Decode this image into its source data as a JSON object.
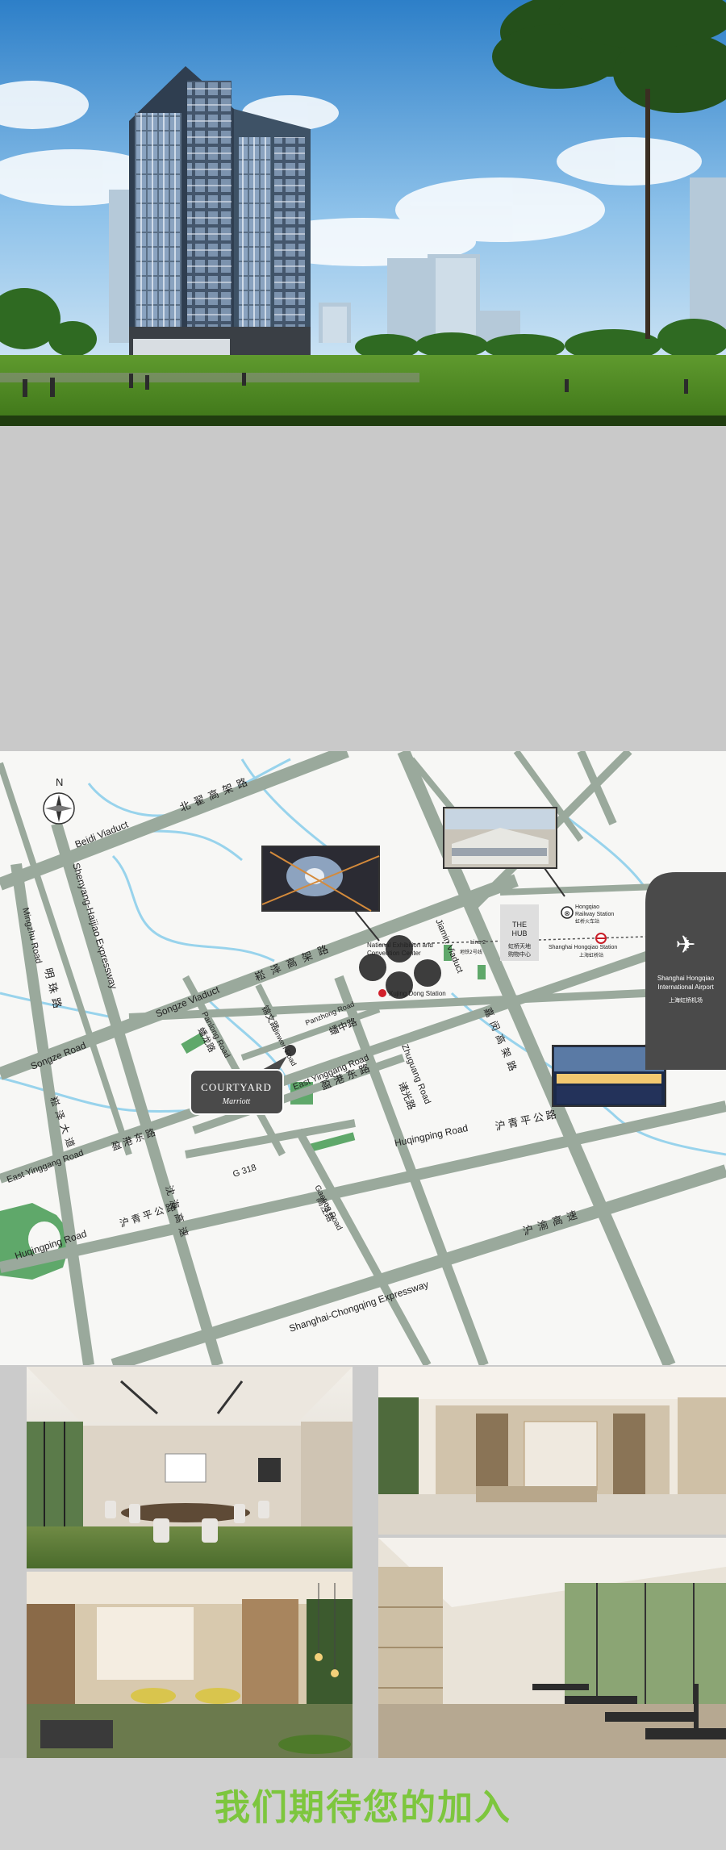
{
  "map": {
    "north": "N",
    "roads": {
      "beidi_viaduct_en": "Beidi Viaduct",
      "beidi_viaduct_cn": "北翟高架路",
      "mingzhu_road_en": "Mingzhu Road",
      "mingzhu_road_cn": "明珠路",
      "shenyang_haijiao": "Shenyang-Haijiao Expressway",
      "songze_viaduct_en": "Songze Viaduct",
      "songze_viaduct_cn": "崧泽高架路",
      "songze_road_en": "Songze Road",
      "songze_road_cn": "崧泽大道",
      "panlong_road_en": "Panlong Road",
      "panlong_road_cn": "蟠龙路",
      "jinwen_road_en": "Jinwen Road",
      "jinwen_road_cn": "锦文路",
      "panzhong_road_en": "Panzhong Road",
      "panzhong_road_cn": "蟠中路",
      "east_yinggang_en": "East Yinggang Road",
      "east_yinggang_cn": "盈港东路",
      "east_yinggang_left_en": "East Yinggang Road",
      "east_yinggang_left_cn": "盈港东路",
      "zhuguang_road_en": "Zhuguang Road",
      "zhuguang_road_cn": "诸光路",
      "jiamin_viaduct_en": "Jiamin Viaduct",
      "jiamin_viaduct_cn": "嘉闵高架路",
      "huqingping_road_en": "Huqingping Road",
      "huqingping_road_cn": "沪青平公路",
      "huqingping_left_en": "Huqingping Road",
      "huqingping_left_cn": "沪青平公路",
      "g318": "G 318",
      "gaoting_road_en": "Gaoting Road",
      "gaoting_road_cn": "高泾路",
      "shanghai_chongqing": "Shanghai-Chongqing Expressway",
      "shanghai_chongqing_cn": "沪渝高速",
      "shenhai_cn": "沈海高速"
    },
    "places": {
      "nec_line1": "National Exhibition and",
      "nec_line2": "Convention Center",
      "xujing_dong": "Xujing Dong Station",
      "the_hub_line1": "THE",
      "the_hub_line2": "HUB",
      "the_hub_cn_1": "虹桥天地",
      "the_hub_cn_2": "购物中心",
      "line2": "Line 2",
      "line2_cn": "地铁2号线",
      "hq_station_en": "Shanghai Hongqiao Station",
      "hq_station_cn": "上海虹桥站",
      "hq_railway_en_1": "Hongqiao",
      "hq_railway_en_2": "Railway Station",
      "hq_railway_cn": "虹桥火车站",
      "airport_en_1": "Shanghai Hongqiao",
      "airport_en_2": "International Airport",
      "airport_cn": "上海虹桥机场"
    },
    "hotel": {
      "brand": "COURTYARD",
      "sub": "Marriott"
    },
    "colors": {
      "road": "#9aa99c",
      "water": "#98d3ec",
      "park": "#5fa86a",
      "callout": "#4a4a4a"
    }
  },
  "footer": {
    "text": "我们期待您的加入",
    "color": "#7dc63e"
  }
}
